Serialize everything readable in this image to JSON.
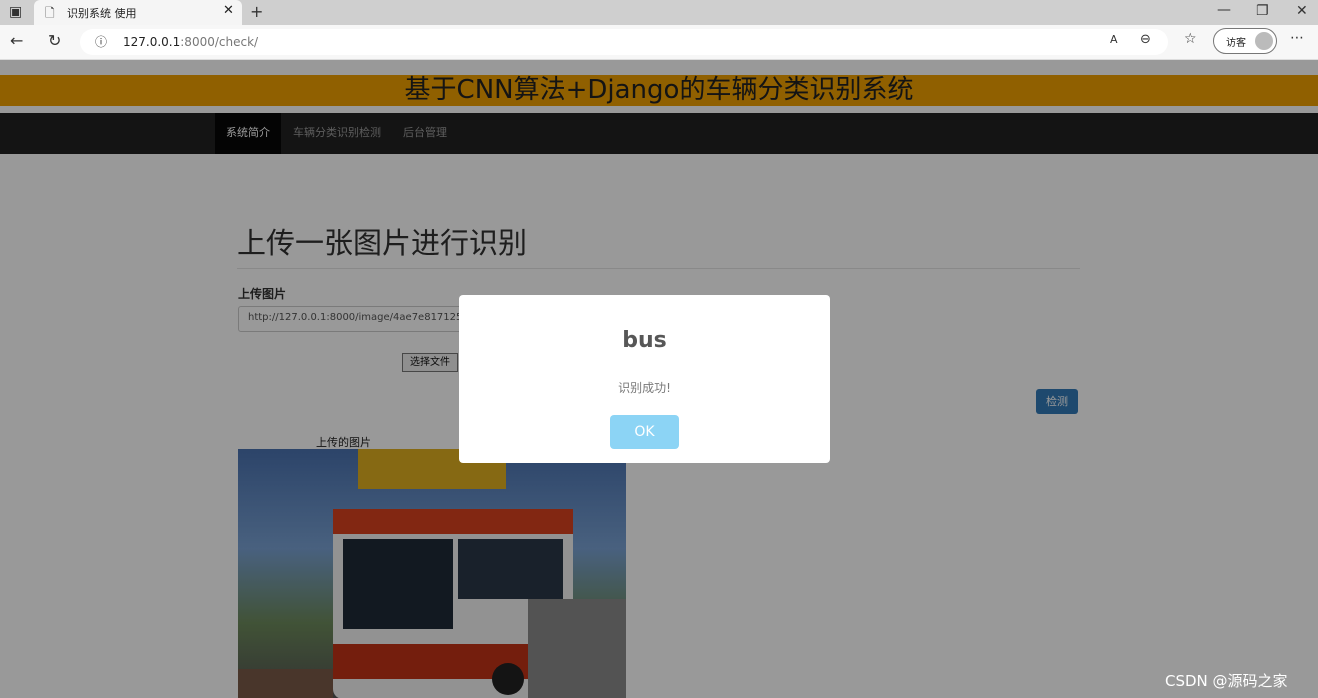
{
  "browser": {
    "tab_title": "识别系统 使用",
    "tab_close": "✕",
    "new_tab": "+",
    "url_host": "127.0.0.1",
    "url_rest": ":8000/check/",
    "guest_label": "访客",
    "window_min": "—",
    "window_restore": "❐",
    "window_close": "✕"
  },
  "page": {
    "banner_title": "基于CNN算法+Django的车辆分类识别系统",
    "nav": [
      "系统简介",
      "车辆分类识别检测",
      "后台管理"
    ],
    "heading": "上传一张图片进行识别",
    "upload_label": "上传图片",
    "upload_value": "http://127.0.0.1:8000/image/4ae7e8171255",
    "choose_file": "选择文件",
    "detect_button": "检测",
    "image_caption": "上传的图片"
  },
  "modal": {
    "title": "bus",
    "text": "识别成功!",
    "ok": "OK"
  },
  "watermark": "CSDN @源码之家"
}
